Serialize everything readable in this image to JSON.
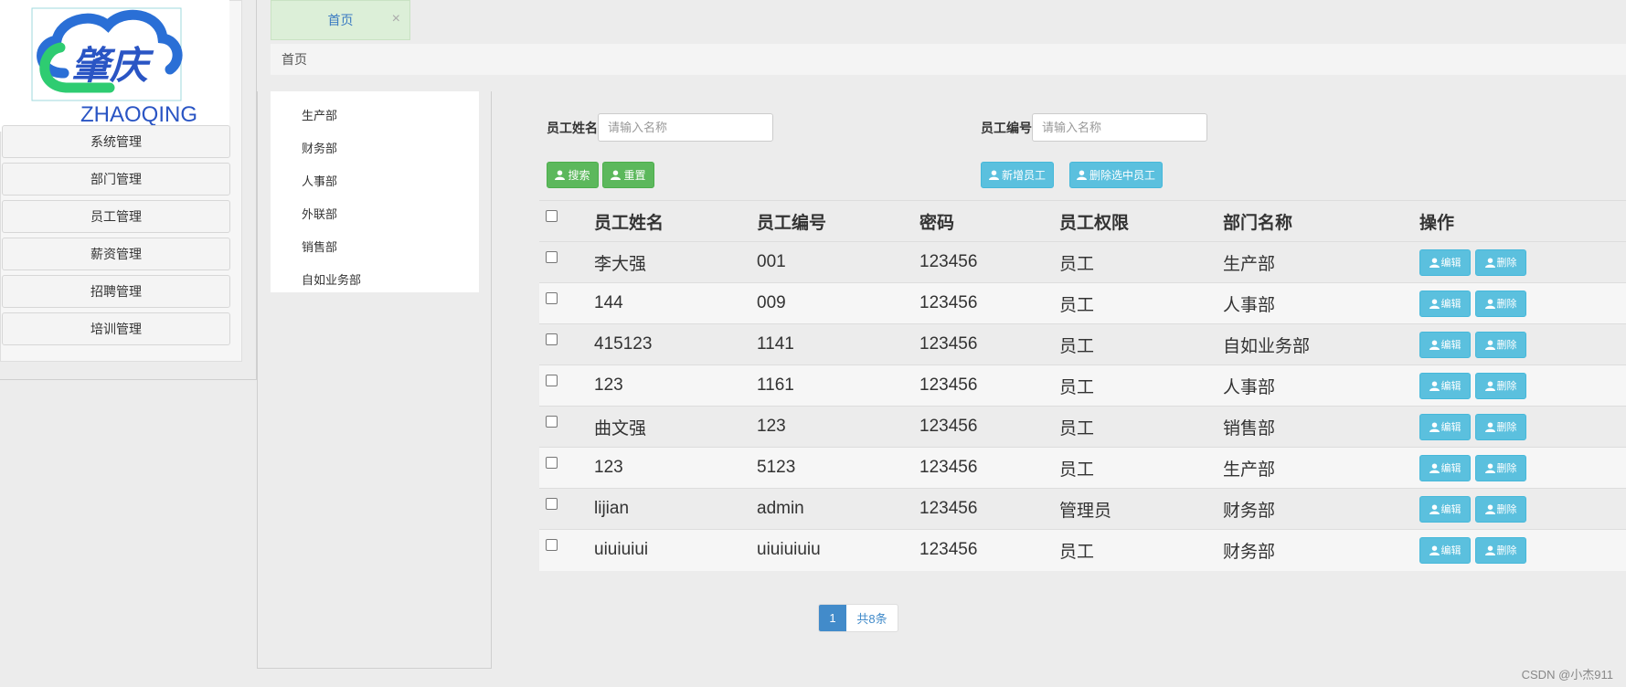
{
  "logo": {
    "brand_cn": "肇庆",
    "brand_en": "ZHAOQING"
  },
  "sidebar": {
    "items": [
      {
        "label": "系统管理"
      },
      {
        "label": "部门管理"
      },
      {
        "label": "员工管理"
      },
      {
        "label": "薪资管理"
      },
      {
        "label": "招聘管理"
      },
      {
        "label": "培训管理"
      }
    ]
  },
  "tabs": [
    {
      "label": "首页",
      "close": "×"
    }
  ],
  "breadcrumb": "首页",
  "departments": [
    "生产部",
    "财务部",
    "人事部",
    "外联部",
    "销售部",
    "自如业务部"
  ],
  "search": {
    "name_label": "员工姓名",
    "name_placeholder": "请输入名称",
    "number_label": "员工编号",
    "number_placeholder": "请输入名称",
    "search_btn": "搜索",
    "reset_btn": "重置",
    "add_btn": "新增员工",
    "delete_selected_btn": "删除选中员工"
  },
  "table": {
    "headers": [
      "员工姓名",
      "员工编号",
      "密码",
      "员工权限",
      "部门名称",
      "操作"
    ],
    "edit_label": "编辑",
    "delete_label": "删除",
    "rows": [
      [
        "李大强",
        "001",
        "123456",
        "员工",
        "生产部"
      ],
      [
        "144",
        "009",
        "123456",
        "员工",
        "人事部"
      ],
      [
        "415123",
        "1141",
        "123456",
        "员工",
        "自如业务部"
      ],
      [
        "123",
        "1161",
        "123456",
        "员工",
        "人事部"
      ],
      [
        "曲文强",
        "123",
        "123456",
        "员工",
        "销售部"
      ],
      [
        "123",
        "5123",
        "123456",
        "员工",
        "生产部"
      ],
      [
        "lijian",
        "admin",
        "123456",
        "管理员",
        "财务部"
      ],
      [
        "uiuiuiui",
        "uiuiuiuiu",
        "123456",
        "员工",
        "财务部"
      ]
    ]
  },
  "pagination": {
    "current": "1",
    "total": "共8条"
  },
  "watermark": "CSDN @小杰911",
  "colors": {
    "green": "#5cb85c",
    "blue": "#5bc0de",
    "primary": "#428bca",
    "tab_bg": "#dcefd8"
  }
}
